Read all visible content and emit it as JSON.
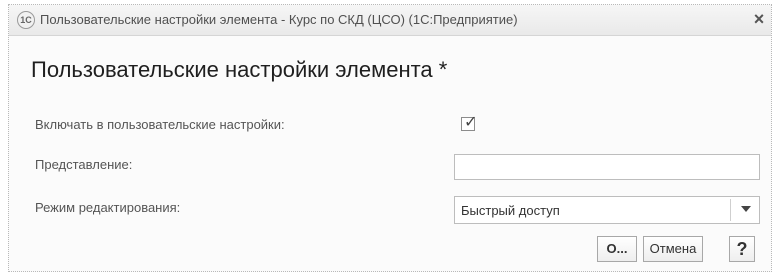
{
  "window": {
    "icon_text": "1С",
    "title": "Пользовательские настройки элемента - Курс по СКД (ЦСО) (1С:Предприятие)",
    "close_label": "×"
  },
  "form": {
    "title": "Пользовательские настройки элемента *",
    "include_label": "Включать в пользовательские настройки:",
    "include_checked_mark": "✓",
    "representation_label": "Представление:",
    "representation_value": "",
    "edit_mode_label": "Режим редактирования:",
    "edit_mode_value": "Быстрый доступ"
  },
  "buttons": {
    "ok_label": "О...",
    "cancel_label": "Отмена",
    "help_label": "?"
  }
}
